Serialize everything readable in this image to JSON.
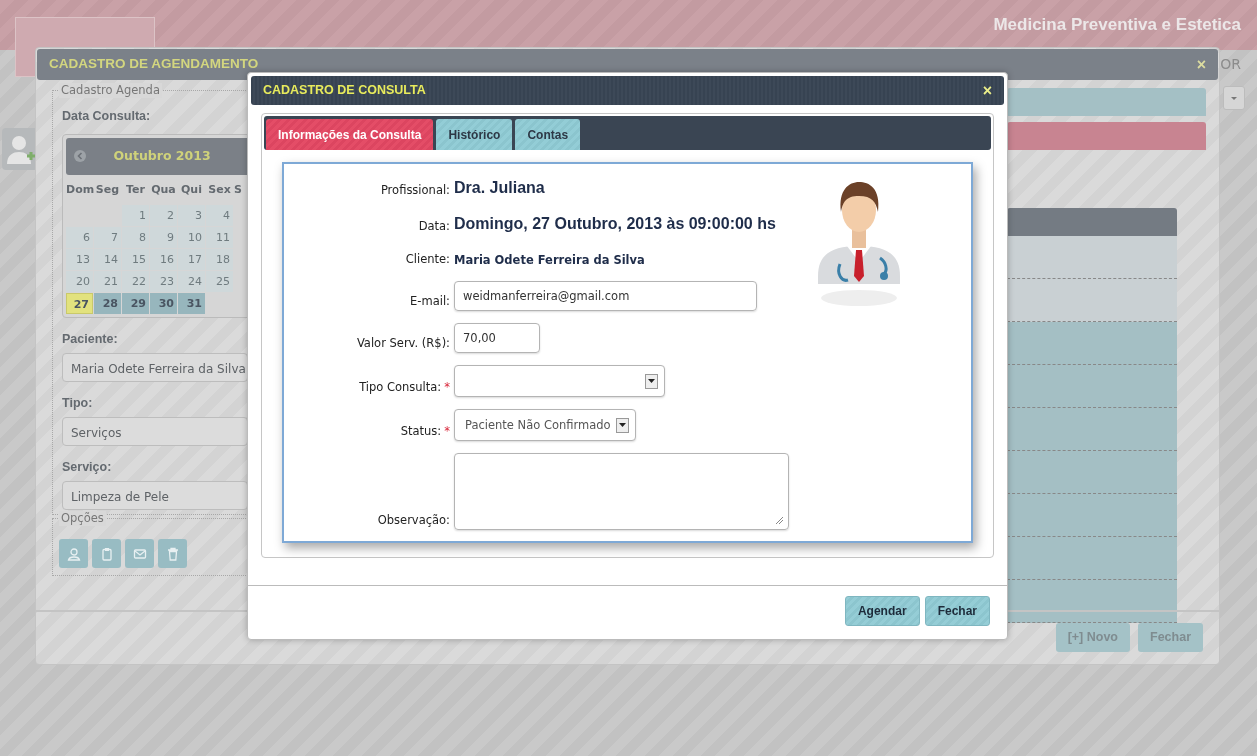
{
  "app_header": {
    "title": "Medicina Preventiva e Estetica",
    "side_text": "OR"
  },
  "scheduling_dialog": {
    "title": "CADASTRO DE AGENDAMENTO",
    "close": "×",
    "fieldset_legend": "Cadastro Agenda",
    "date_label": "Data Consulta:",
    "calendar": {
      "month": "Outubro 2013",
      "weekdays": [
        "Dom",
        "Seg",
        "Ter",
        "Qua",
        "Qui",
        "Sex",
        "S"
      ],
      "weeks": [
        [
          {
            "day": "1",
            "disabled": true,
            "selected": false
          },
          {
            "day": "2",
            "disabled": true,
            "selected": false
          },
          {
            "day": "3",
            "disabled": true,
            "selected": false
          },
          {
            "day": "4",
            "disabled": true,
            "selected": false
          }
        ],
        [
          {
            "day": "6",
            "disabled": true,
            "selected": false
          },
          {
            "day": "7",
            "disabled": true,
            "selected": false
          },
          {
            "day": "8",
            "disabled": true,
            "selected": false
          },
          {
            "day": "9",
            "disabled": true,
            "selected": false
          },
          {
            "day": "10",
            "disabled": true,
            "selected": false
          },
          {
            "day": "11",
            "disabled": true,
            "selected": false
          }
        ],
        [
          {
            "day": "13",
            "disabled": true,
            "selected": false
          },
          {
            "day": "14",
            "disabled": true,
            "selected": false
          },
          {
            "day": "15",
            "disabled": true,
            "selected": false
          },
          {
            "day": "16",
            "disabled": true,
            "selected": false
          },
          {
            "day": "17",
            "disabled": true,
            "selected": false
          },
          {
            "day": "18",
            "disabled": true,
            "selected": false
          }
        ],
        [
          {
            "day": "20",
            "disabled": true,
            "selected": false
          },
          {
            "day": "21",
            "disabled": true,
            "selected": false
          },
          {
            "day": "22",
            "disabled": true,
            "selected": false
          },
          {
            "day": "23",
            "disabled": true,
            "selected": false
          },
          {
            "day": "24",
            "disabled": true,
            "selected": false
          },
          {
            "day": "25",
            "disabled": true,
            "selected": false
          }
        ],
        [
          {
            "day": "27",
            "disabled": false,
            "selected": true
          },
          {
            "day": "28",
            "disabled": false,
            "selected": false
          },
          {
            "day": "29",
            "disabled": false,
            "selected": false
          },
          {
            "day": "30",
            "disabled": false,
            "selected": false
          },
          {
            "day": "31",
            "disabled": false,
            "selected": false
          }
        ]
      ]
    },
    "fields": [
      {
        "label": "Paciente:",
        "value": "Maria Odete Ferreira da Silva"
      },
      {
        "label": "Tipo:",
        "value": "Serviços"
      },
      {
        "label": "Serviço:",
        "value": "Limpeza de Pele"
      }
    ],
    "options_legend": "Opções",
    "buttons": [
      "[+] Novo",
      "Fechar"
    ]
  },
  "consultation_dialog": {
    "title": "CADASTRO DE CONSULTA",
    "close": "×",
    "tabs": [
      {
        "label": "Informações da Consulta",
        "selected": true
      },
      {
        "label": "Histórico",
        "selected": false
      },
      {
        "label": "Contas",
        "selected": false
      }
    ],
    "rows": [
      {
        "kind": "title",
        "label": "Profissional:",
        "value": "Dra. Juliana"
      },
      {
        "kind": "title",
        "label": "Data:",
        "value": "Domingo, 27 Outubro, 2013 às 09:00:00 hs"
      },
      {
        "kind": "text",
        "label": "Cliente:",
        "value": "Maria Odete Ferreira da Silva"
      },
      {
        "kind": "input",
        "label": "E-mail:",
        "value": "weidmanferreira@gmail.com"
      },
      {
        "kind": "short_input",
        "label": "Valor Serv. (R$):",
        "value": "70,00"
      },
      {
        "kind": "select",
        "label": "Tipo Consulta:",
        "required_mark": "*"
      },
      {
        "kind": "short_select",
        "label": "Status:",
        "required_mark": "*",
        "value": "Paciente Não Confirmado"
      },
      {
        "kind": "textarea",
        "label": "Observação:"
      }
    ],
    "buttons": [
      "Agendar",
      "Fechar"
    ]
  }
}
